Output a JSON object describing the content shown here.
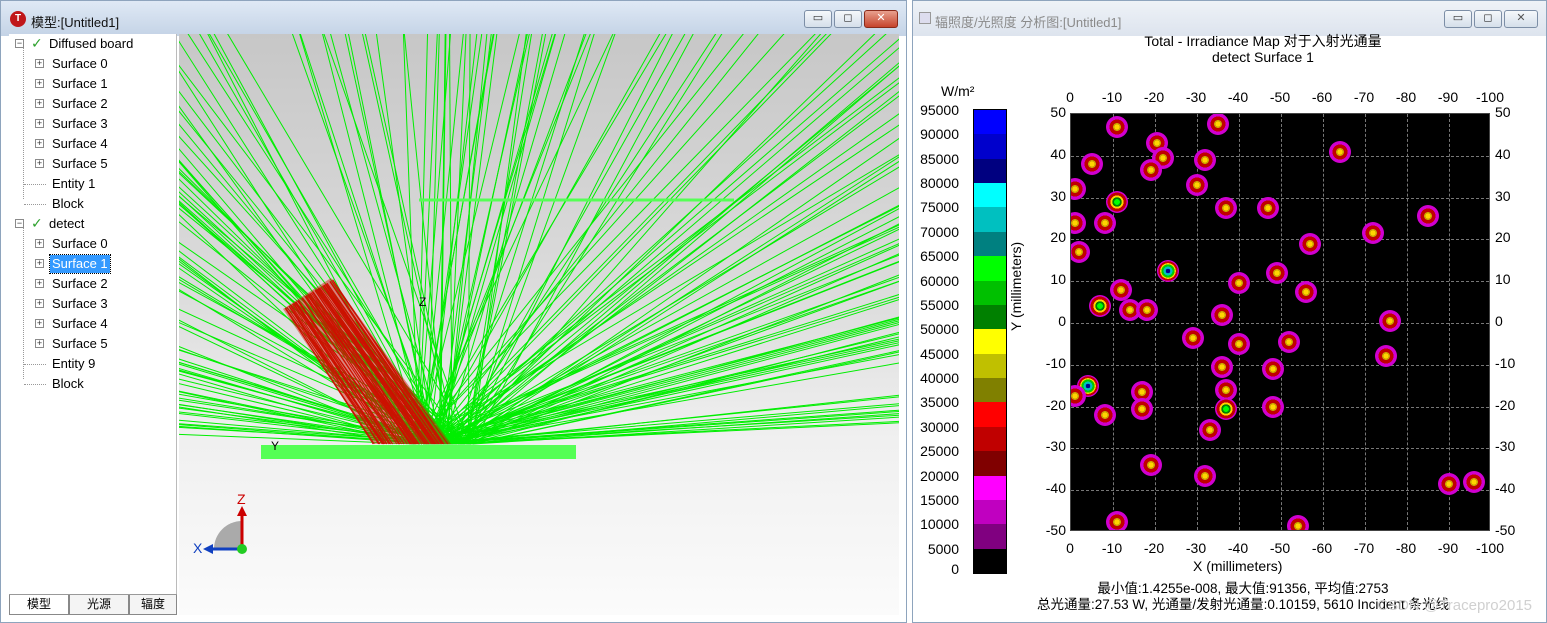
{
  "model_window": {
    "title": "模型:[Untitled1]",
    "buttons": {
      "minimize": "▭",
      "restore": "◻",
      "close": "✕"
    },
    "tree": [
      {
        "label": "Diffused board",
        "checked": true,
        "children": [
          "Surface 0",
          "Surface 1",
          "Surface 2",
          "Surface 3",
          "Surface 4",
          "Surface 5",
          "Entity 1",
          "Block"
        ]
      },
      {
        "label": "detect",
        "checked": true,
        "children": [
          "Surface 0",
          "Surface 1",
          "Surface 2",
          "Surface 3",
          "Surface 4",
          "Surface 5",
          "Entity 9",
          "Block"
        ]
      }
    ],
    "selected": "detect / Surface 1",
    "tabs": [
      "模型",
      "光源",
      "辐度"
    ],
    "viewport": {
      "axis_labels": {
        "z_origin": "Z",
        "y_origin": "Y"
      },
      "triad": {
        "z": "Z",
        "x": "X"
      },
      "colors": {
        "rays": "#00ee00",
        "source_rays": "#cc1100",
        "board": "#55ff55"
      }
    }
  },
  "irradiance_window": {
    "title": "辐照度/光照度 分析图:[Untitled1]",
    "buttons": {
      "minimize": "▭",
      "restore": "◻",
      "close": "✕"
    },
    "plot_title_line1": "Total - Irradiance Map 对于入射光通量",
    "plot_title_line2": "detect Surface 1",
    "colorbar": {
      "unit": "W/m²",
      "ticks": [
        "95000",
        "90000",
        "85000",
        "80000",
        "75000",
        "70000",
        "65000",
        "60000",
        "55000",
        "50000",
        "45000",
        "40000",
        "35000",
        "30000",
        "25000",
        "20000",
        "15000",
        "10000",
        "5000",
        "0"
      ],
      "colors": [
        "#0000ff",
        "#0000cc",
        "#000080",
        "#00ffff",
        "#00c0c0",
        "#008080",
        "#00ff00",
        "#00c000",
        "#008000",
        "#ffff00",
        "#c0c000",
        "#808000",
        "#ff0000",
        "#c00000",
        "#800000",
        "#ff00ff",
        "#c000c0",
        "#800080",
        "#000000"
      ]
    },
    "chart_data": {
      "type": "heatmap",
      "title": "Total - Irradiance Map 对于入射光通量",
      "subtitle": "detect Surface 1",
      "xlabel": "X (millimeters)",
      "ylabel": "Y (millimeters)",
      "x_ticks": [
        "0",
        "-10",
        "-20",
        "-30",
        "-40",
        "-50",
        "-60",
        "-70",
        "-80",
        "-90",
        "-100"
      ],
      "y_ticks": [
        "50",
        "40",
        "30",
        "20",
        "10",
        "0",
        "-10",
        "-20",
        "-30",
        "-40",
        "-50"
      ],
      "xlim": [
        0,
        -100
      ],
      "ylim": [
        -50,
        50
      ],
      "grid": true,
      "spots": [
        {
          "x": -11,
          "y": 47
        },
        {
          "x": -35,
          "y": 47.5
        },
        {
          "x": -20.5,
          "y": 43
        },
        {
          "x": -22,
          "y": 39.5
        },
        {
          "x": -5,
          "y": 38
        },
        {
          "x": -32,
          "y": 39
        },
        {
          "x": -64,
          "y": 41
        },
        {
          "x": -19,
          "y": 36.5
        },
        {
          "x": -30,
          "y": 33
        },
        {
          "x": -1,
          "y": 32
        },
        {
          "x": -11,
          "y": 29,
          "kind": "hot2"
        },
        {
          "x": -37,
          "y": 27.5
        },
        {
          "x": -47,
          "y": 27.5
        },
        {
          "x": -85,
          "y": 25.5
        },
        {
          "x": -1,
          "y": 24
        },
        {
          "x": -8,
          "y": 24
        },
        {
          "x": -72,
          "y": 21.5
        },
        {
          "x": -57,
          "y": 19
        },
        {
          "x": -2,
          "y": 17
        },
        {
          "x": -23,
          "y": 12.5,
          "kind": "hot"
        },
        {
          "x": -49,
          "y": 12
        },
        {
          "x": -40,
          "y": 9.5
        },
        {
          "x": -12,
          "y": 8
        },
        {
          "x": -56,
          "y": 7.5
        },
        {
          "x": -7,
          "y": 4,
          "kind": "hot2"
        },
        {
          "x": -14,
          "y": 3
        },
        {
          "x": -18,
          "y": 3
        },
        {
          "x": -36,
          "y": 2
        },
        {
          "x": -76,
          "y": 0.5
        },
        {
          "x": -29,
          "y": -3.5
        },
        {
          "x": -52,
          "y": -4.5
        },
        {
          "x": -40,
          "y": -5
        },
        {
          "x": -75,
          "y": -8
        },
        {
          "x": -36,
          "y": -10.5
        },
        {
          "x": -48,
          "y": -11
        },
        {
          "x": -4,
          "y": -15,
          "kind": "hot"
        },
        {
          "x": -17,
          "y": -16.5
        },
        {
          "x": -37,
          "y": -16
        },
        {
          "x": -1,
          "y": -17.5
        },
        {
          "x": -17,
          "y": -20.5
        },
        {
          "x": -37,
          "y": -20.5,
          "kind": "hot2"
        },
        {
          "x": -48,
          "y": -20
        },
        {
          "x": -8,
          "y": -22
        },
        {
          "x": -33,
          "y": -25.5
        },
        {
          "x": -19,
          "y": -34
        },
        {
          "x": -32,
          "y": -36.5
        },
        {
          "x": -90,
          "y": -38.5
        },
        {
          "x": -96,
          "y": -38
        },
        {
          "x": -11,
          "y": -47.5
        },
        {
          "x": -54,
          "y": -48.5
        }
      ]
    },
    "stats_line1": "最小值:1.4255e-008, 最大值:91356, 平均值:2753",
    "stats_line2": "总光通量:27.53 W, 光通量/发射光通量:0.10159, 5610 Incident 条光线",
    "watermark": "CSDN @Tracepro2015"
  }
}
